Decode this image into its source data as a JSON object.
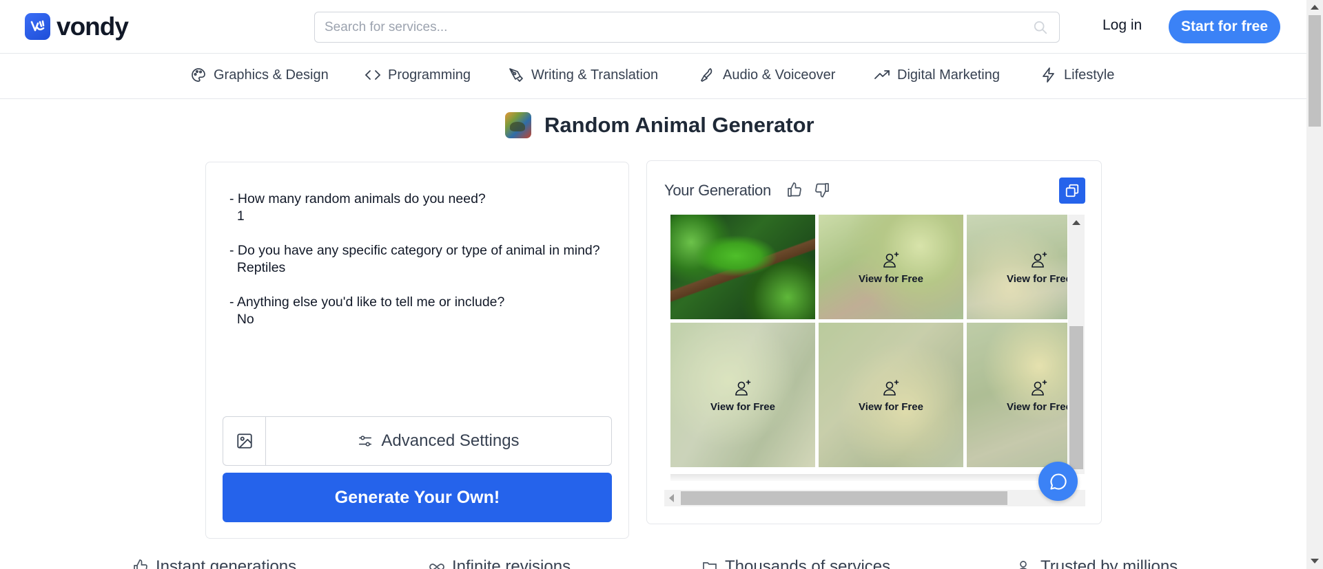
{
  "header": {
    "brand": "vondy",
    "search_placeholder": "Search for services...",
    "login_label": "Log in",
    "start_label": "Start for free",
    "accent_color": "#3b82f6"
  },
  "categories": [
    {
      "label": "Graphics & Design",
      "icon": "palette-icon"
    },
    {
      "label": "Programming",
      "icon": "code-icon"
    },
    {
      "label": "Writing & Translation",
      "icon": "pen-nib-icon"
    },
    {
      "label": "Audio & Voiceover",
      "icon": "microphone-icon"
    },
    {
      "label": "Digital Marketing",
      "icon": "trending-up-icon"
    },
    {
      "label": "Lifestyle",
      "icon": "lightning-icon"
    }
  ],
  "page": {
    "title": "Random Animal Generator"
  },
  "prompt": {
    "lines": [
      "- How many random animals do you need?",
      "  1",
      "",
      "- Do you have any specific category or type of animal in mind?",
      "  Reptiles",
      "",
      "- Anything else you'd like to tell me or include?",
      "  No"
    ],
    "advanced_label": "Advanced Settings",
    "generate_label": "Generate Your Own!",
    "primary_color": "#2563eb"
  },
  "generation": {
    "title": "Your Generation",
    "view_label": "View for Free",
    "tiles": [
      {
        "kind": "image",
        "subject": "green lizard on branch"
      },
      {
        "kind": "locked"
      },
      {
        "kind": "locked"
      },
      {
        "kind": "locked"
      },
      {
        "kind": "locked"
      },
      {
        "kind": "locked"
      }
    ]
  },
  "features": [
    {
      "label": "Instant generations",
      "icon": "thumbs-up-icon"
    },
    {
      "label": "Infinite revisions",
      "icon": "infinity-icon"
    },
    {
      "label": "Thousands of services",
      "icon": "folders-icon"
    },
    {
      "label": "Trusted by millions",
      "icon": "users-icon"
    }
  ]
}
